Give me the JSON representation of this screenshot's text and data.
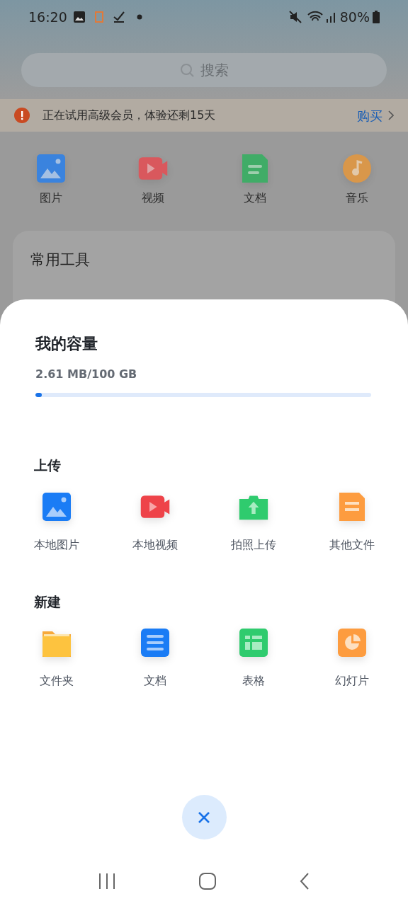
{
  "status_bar": {
    "time": "16:20",
    "battery": "80%"
  },
  "search": {
    "placeholder": "搜索"
  },
  "trial_banner": {
    "text": "正在试用高级会员，体验还剩15天",
    "action": "购买"
  },
  "categories": [
    {
      "kind": "image",
      "label": "图片"
    },
    {
      "kind": "video",
      "label": "视频"
    },
    {
      "kind": "doc",
      "label": "文档"
    },
    {
      "kind": "music",
      "label": "音乐"
    }
  ],
  "tools_card": {
    "title": "常用工具"
  },
  "sheet": {
    "storage": {
      "title": "我的容量",
      "usage": "2.61 MB/100 GB",
      "level": 0.02
    },
    "sections": [
      {
        "title": "上传",
        "items": [
          {
            "kind": "image",
            "label": "本地图片"
          },
          {
            "kind": "video",
            "label": "本地视频"
          },
          {
            "kind": "camera",
            "label": "拍照上传"
          },
          {
            "kind": "file",
            "label": "其他文件"
          }
        ]
      },
      {
        "title": "新建",
        "items": [
          {
            "kind": "folder",
            "label": "文件夹"
          },
          {
            "kind": "text",
            "label": "文档"
          },
          {
            "kind": "sheet",
            "label": "表格"
          },
          {
            "kind": "slides",
            "label": "幻灯片"
          }
        ]
      }
    ]
  }
}
